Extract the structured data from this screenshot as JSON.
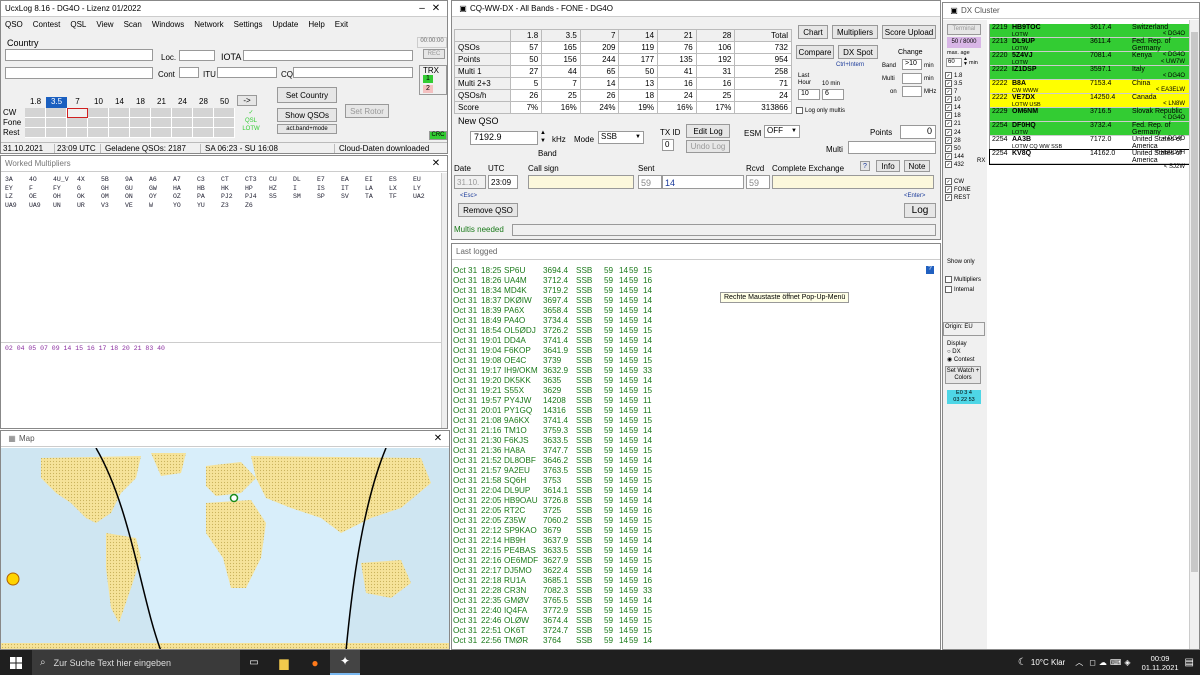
{
  "main": {
    "title": "UcxLog 8.16 - DG4O - Lizenz 01/2022",
    "menu": [
      "QSO",
      "Contest",
      "QSL",
      "View",
      "Scan",
      "Windows",
      "Network",
      "Settings",
      "Update",
      "Help",
      "Exit"
    ],
    "country_label": "Country",
    "time_readout": "00:00:00",
    "rec": "REC",
    "loc": "Loc.",
    "iota": "IOTA",
    "cont": "Cont",
    "itu": "ITU",
    "cq": "CQ",
    "trx": "TRX",
    "bands": [
      "1.8",
      "3.5",
      "7",
      "10",
      "14",
      "18",
      "21",
      "24",
      "28",
      "50"
    ],
    "active_band": "3.5",
    "arrow_btn": "->",
    "modes": [
      "CW",
      "Fone",
      "Rest"
    ],
    "qsl_labels": [
      "QSL",
      "LOTW"
    ],
    "set_country": "Set Country",
    "show_qsos": "Show QSOs",
    "set_rotor": "Set Rotor",
    "band_mode_btn": "act.band+mode",
    "status": [
      "31.10.2021",
      "23:09 UTC",
      "Geladene QSOs: 2187",
      "SA 06:23 - SU 16:08",
      "Cloud-Daten downloaded"
    ],
    "crc": "CRC"
  },
  "worked": {
    "title": "Worked Multipliers",
    "rows": [
      [
        "3A",
        "4O",
        "4U_V",
        "4X",
        "5B",
        "9A",
        "A6",
        "A7",
        "C3",
        "CT",
        "CT3",
        "CU",
        "DL",
        "E7",
        "EA",
        "EI",
        "ES",
        "EU"
      ],
      [
        "EY",
        "F",
        "FY",
        "G",
        "GH",
        "GU",
        "GW",
        "HA",
        "HB",
        "HK",
        "HP",
        "HZ",
        "I",
        "IS",
        "IT",
        "LA",
        "LX",
        "LY"
      ],
      [
        "LZ",
        "OE",
        "OH",
        "OK",
        "OM",
        "ON",
        "OY",
        "OZ",
        "PA",
        "PJ2",
        "PJ4",
        "S5",
        "SM",
        "SP",
        "SV",
        "TA",
        "TF",
        "UA2"
      ],
      [
        "UA9",
        "UA9",
        "UN",
        "UR",
        "V3",
        "VE",
        "W",
        "YO",
        "YU",
        "Z3",
        "Z6"
      ]
    ],
    "zones": "02 04 05 07 09 14 15 16 17 18 20 21 83 40"
  },
  "map": {
    "title": "Map"
  },
  "contest": {
    "title": "CQ-WW-DX - All Bands - FONE - DG4O",
    "headers": [
      "",
      "1.8",
      "3.5",
      "7",
      "14",
      "21",
      "28",
      "Total"
    ],
    "rows": [
      [
        "QSOs",
        "57",
        "165",
        "209",
        "119",
        "76",
        "106",
        "732"
      ],
      [
        "Points",
        "50",
        "156",
        "244",
        "177",
        "135",
        "192",
        "954"
      ],
      [
        "Multi 1",
        "27",
        "44",
        "65",
        "50",
        "41",
        "31",
        "258"
      ],
      [
        "Multi 2+3",
        "5",
        "7",
        "14",
        "13",
        "16",
        "16",
        "71"
      ],
      [
        "QSOs/h",
        "26",
        "25",
        "26",
        "18",
        "24",
        "25",
        "24"
      ],
      [
        "Score",
        "7%",
        "16%",
        "24%",
        "19%",
        "16%",
        "17%",
        "313866"
      ]
    ],
    "btn_chart": "Chart",
    "btn_multipliers": "Multipliers",
    "btn_score_upload": "Score Upload",
    "btn_compare": "Compare",
    "btn_dxspot": "DX Spot",
    "ctrl_intern": "Ctrl+Intern",
    "change": "Change",
    "band_lbl": "Band",
    "band_val": ">10",
    "multi_lbl": "Multi",
    "on_lbl": "on",
    "min1": "min",
    "min2": "min",
    "mhz": "MHz",
    "last_hour": "Last Hour",
    "ten_min": "10 min",
    "last_hour_val": "10",
    "ten_min_val": "6",
    "log_only_multis": "Log only multis",
    "new_qso": "New QSO",
    "freq": "7192.9",
    "khz": "kHz",
    "band_word": "Band",
    "mode_lbl": "Mode",
    "mode_val": "SSB",
    "txid_lbl": "TX ID",
    "txid_val": "0",
    "edit_log": "Edit Log",
    "undo_log": "Undo Log",
    "esm_lbl": "ESM",
    "esm_val": "OFF",
    "points_lbl": "Points",
    "points_val": "0",
    "multi_field": "Multi",
    "date_lbl": "Date",
    "utc_lbl": "UTC",
    "call_lbl": "Call sign",
    "sent_lbl": "Sent",
    "rcvd_lbl": "Rcvd",
    "complete_lbl": "Complete Exchange",
    "q": "?",
    "info": "Info",
    "note": "Note",
    "date_val": "31.10.",
    "utc_val": "23:09",
    "sent_rst": "59",
    "sent_nr": "14",
    "rcvd_rst": "59",
    "esc": "<Esc>",
    "enter": "<Enter>",
    "remove_qso": "Remove QSO",
    "log_btn": "Log",
    "multis_needed": "Multis needed"
  },
  "lastlog": {
    "title": "Last logged",
    "tooltip": "Rechte Maustaste öffnet Pop-Up-Menü",
    "rows": [
      [
        "Oct 31",
        "18:25",
        "SP6U",
        "3694.4",
        "SSB",
        "59",
        "14",
        "59",
        "15"
      ],
      [
        "Oct 31",
        "18:26",
        "UA4M",
        "3712.4",
        "SSB",
        "59",
        "14",
        "59",
        "16"
      ],
      [
        "Oct 31",
        "18:34",
        "MD4K",
        "3719.2",
        "SSB",
        "59",
        "14",
        "59",
        "14"
      ],
      [
        "Oct 31",
        "18:37",
        "DKØIW",
        "3697.4",
        "SSB",
        "59",
        "14",
        "59",
        "14"
      ],
      [
        "Oct 31",
        "18:39",
        "PA6X",
        "3658.4",
        "SSB",
        "59",
        "14",
        "59",
        "14"
      ],
      [
        "Oct 31",
        "18:49",
        "PA4O",
        "3734.4",
        "SSB",
        "59",
        "14",
        "59",
        "14"
      ],
      [
        "Oct 31",
        "18:54",
        "OL5ØDJ",
        "3726.2",
        "SSB",
        "59",
        "14",
        "59",
        "15"
      ],
      [
        "Oct 31",
        "19:01",
        "DD4A",
        "3741.4",
        "SSB",
        "59",
        "14",
        "59",
        "14"
      ],
      [
        "Oct 31",
        "19:04",
        "F6KOP",
        "3641.9",
        "SSB",
        "59",
        "14",
        "59",
        "14"
      ],
      [
        "Oct 31",
        "19:08",
        "OE4C",
        "3739",
        "SSB",
        "59",
        "14",
        "59",
        "15"
      ],
      [
        "Oct 31",
        "19:17",
        "IH9/OKM",
        "3632.9",
        "SSB",
        "59",
        "14",
        "59",
        "33"
      ],
      [
        "Oct 31",
        "19:20",
        "DK5KK",
        "3635",
        "SSB",
        "59",
        "14",
        "59",
        "14"
      ],
      [
        "Oct 31",
        "19:21",
        "S55X",
        "3629",
        "SSB",
        "59",
        "14",
        "59",
        "15"
      ],
      [
        "Oct 31",
        "19:57",
        "PY4JW",
        "14208",
        "SSB",
        "59",
        "14",
        "59",
        "11"
      ],
      [
        "Oct 31",
        "20:01",
        "PY1GQ",
        "14316",
        "SSB",
        "59",
        "14",
        "59",
        "11"
      ],
      [
        "Oct 31",
        "21:08",
        "9A6KX",
        "3741.4",
        "SSB",
        "59",
        "14",
        "59",
        "15"
      ],
      [
        "Oct 31",
        "21:16",
        "TM1O",
        "3759.3",
        "SSB",
        "59",
        "14",
        "59",
        "14"
      ],
      [
        "Oct 31",
        "21:30",
        "F6KJS",
        "3633.5",
        "SSB",
        "59",
        "14",
        "59",
        "14"
      ],
      [
        "Oct 31",
        "21:36",
        "HA8A",
        "3747.7",
        "SSB",
        "59",
        "14",
        "59",
        "15"
      ],
      [
        "Oct 31",
        "21:52",
        "DL8OBF",
        "3646.2",
        "SSB",
        "59",
        "14",
        "59",
        "14"
      ],
      [
        "Oct 31",
        "21:57",
        "9A2EU",
        "3763.5",
        "SSB",
        "59",
        "14",
        "59",
        "15"
      ],
      [
        "Oct 31",
        "21:58",
        "SQ6H",
        "3753",
        "SSB",
        "59",
        "14",
        "59",
        "15"
      ],
      [
        "Oct 31",
        "22:04",
        "DL9UP",
        "3614.1",
        "SSB",
        "59",
        "14",
        "59",
        "14"
      ],
      [
        "Oct 31",
        "22:05",
        "HB9OAU",
        "3726.8",
        "SSB",
        "59",
        "14",
        "59",
        "14"
      ],
      [
        "Oct 31",
        "22:05",
        "RT2C",
        "3725",
        "SSB",
        "59",
        "14",
        "59",
        "16"
      ],
      [
        "Oct 31",
        "22:05",
        "Z35W",
        "7060.2",
        "SSB",
        "59",
        "14",
        "59",
        "15"
      ],
      [
        "Oct 31",
        "22:12",
        "SP9KAO",
        "3679",
        "SSB",
        "59",
        "14",
        "59",
        "15"
      ],
      [
        "Oct 31",
        "22:14",
        "HB9H",
        "3637.9",
        "SSB",
        "59",
        "14",
        "59",
        "14"
      ],
      [
        "Oct 31",
        "22:15",
        "PE4BAS",
        "3633.5",
        "SSB",
        "59",
        "14",
        "59",
        "14"
      ],
      [
        "Oct 31",
        "22:16",
        "OE6MDF",
        "3627.9",
        "SSB",
        "59",
        "14",
        "59",
        "15"
      ],
      [
        "Oct 31",
        "22:17",
        "DJ5MO",
        "3622.4",
        "SSB",
        "59",
        "14",
        "59",
        "14"
      ],
      [
        "Oct 31",
        "22:18",
        "RU1A",
        "3685.1",
        "SSB",
        "59",
        "14",
        "59",
        "16"
      ],
      [
        "Oct 31",
        "22:28",
        "CR3N",
        "7082.3",
        "SSB",
        "59",
        "14",
        "59",
        "33"
      ],
      [
        "Oct 31",
        "22:35",
        "GMØV",
        "3765.5",
        "SSB",
        "59",
        "14",
        "59",
        "14"
      ],
      [
        "Oct 31",
        "22:40",
        "IQ4FA",
        "3772.9",
        "SSB",
        "59",
        "14",
        "59",
        "15"
      ],
      [
        "Oct 31",
        "22:46",
        "OLØW",
        "3674.4",
        "SSB",
        "59",
        "14",
        "59",
        "15"
      ],
      [
        "Oct 31",
        "22:51",
        "OK6T",
        "3724.7",
        "SSB",
        "59",
        "14",
        "59",
        "15"
      ],
      [
        "Oct 31",
        "22:56",
        "TMØR",
        "3764",
        "SSB",
        "59",
        "14",
        "59",
        "14"
      ]
    ]
  },
  "dx": {
    "title": "DX Cluster",
    "terminal": "Terminal",
    "counter": "50 / 8000",
    "max_age": "max. age",
    "max_age_val": "60",
    "min": "min",
    "bands": [
      "1.8",
      "3.5",
      "7",
      "10",
      "14",
      "18",
      "21",
      "24",
      "28",
      "50",
      "144",
      "432"
    ],
    "rx": "RX",
    "modes": [
      "CW",
      "FONE",
      "REST"
    ],
    "show_only": "Show only",
    "multipliers": "Multipliers",
    "internal": "Internal",
    "origin": "Origin: EU",
    "display": "Display",
    "dx_opt": "DX",
    "contest_opt": "Contest",
    "set_watch": "Set Watch + Colors",
    "times": [
      "E0",
      "3",
      "4"
    ],
    "times2": [
      "03",
      "22",
      "53"
    ],
    "spots": [
      {
        "t": "2219",
        "call": "HB9TOC",
        "f": "3617.4",
        "c": "Switzerland",
        "s": "LOTW",
        "sp": "< DG4O",
        "bg": "#33cc33"
      },
      {
        "t": "2213",
        "call": "DL9UP",
        "f": "3611.4",
        "c": "Fed. Rep. of Germany",
        "s": "LOTW",
        "sp": "< DG4O",
        "bg": "#33cc33"
      },
      {
        "t": "2220",
        "call": "5Z4VJ",
        "f": "7081.4",
        "c": "Kenya",
        "s": "LOTW",
        "sp": "< UW7W",
        "bg": "#33cc33"
      },
      {
        "t": "2222",
        "call": "IZ1DSP",
        "f": "3597.1",
        "c": "Italy",
        "s": "",
        "sp": "< DG4O",
        "bg": "#33cc33"
      },
      {
        "t": "2222",
        "call": "B8A",
        "f": "7153.4",
        "c": "China",
        "s": "CW WWW",
        "sp": "< EA3ELW",
        "bg": "#ffff00"
      },
      {
        "t": "2222",
        "call": "VE7DX",
        "f": "14250.4",
        "c": "Canada",
        "s": "LOTW USB",
        "sp": "< LN8W",
        "bg": "#ffff00"
      },
      {
        "t": "2229",
        "call": "OM6NM",
        "f": "3716.5",
        "c": "Slovak Republic",
        "s": "",
        "sp": "< DG4O",
        "bg": "#33cc33"
      },
      {
        "t": "2254",
        "call": "DF0HQ",
        "f": "3732.4",
        "c": "Fed. Rep. of Germany",
        "s": "LOTW",
        "sp": "< DG4O",
        "bg": "#33cc33"
      },
      {
        "t": "2254",
        "call": "AA3B",
        "f": "7172.0",
        "c": "United States of America",
        "s": "LOTW CQ WW SSB",
        "sp": "< HB9DVH",
        "bg": "#ffffff"
      },
      {
        "t": "2254",
        "call": "KV8Q",
        "f": "14162.0",
        "c": "United States of America",
        "s": "",
        "sp": "< SJ2W",
        "bg": "#ffffff"
      }
    ]
  },
  "taskbar": {
    "search": "Zur Suche Text hier eingeben",
    "weather": "10°C  Klar",
    "time": "00:09",
    "date": "01.11.2021"
  }
}
